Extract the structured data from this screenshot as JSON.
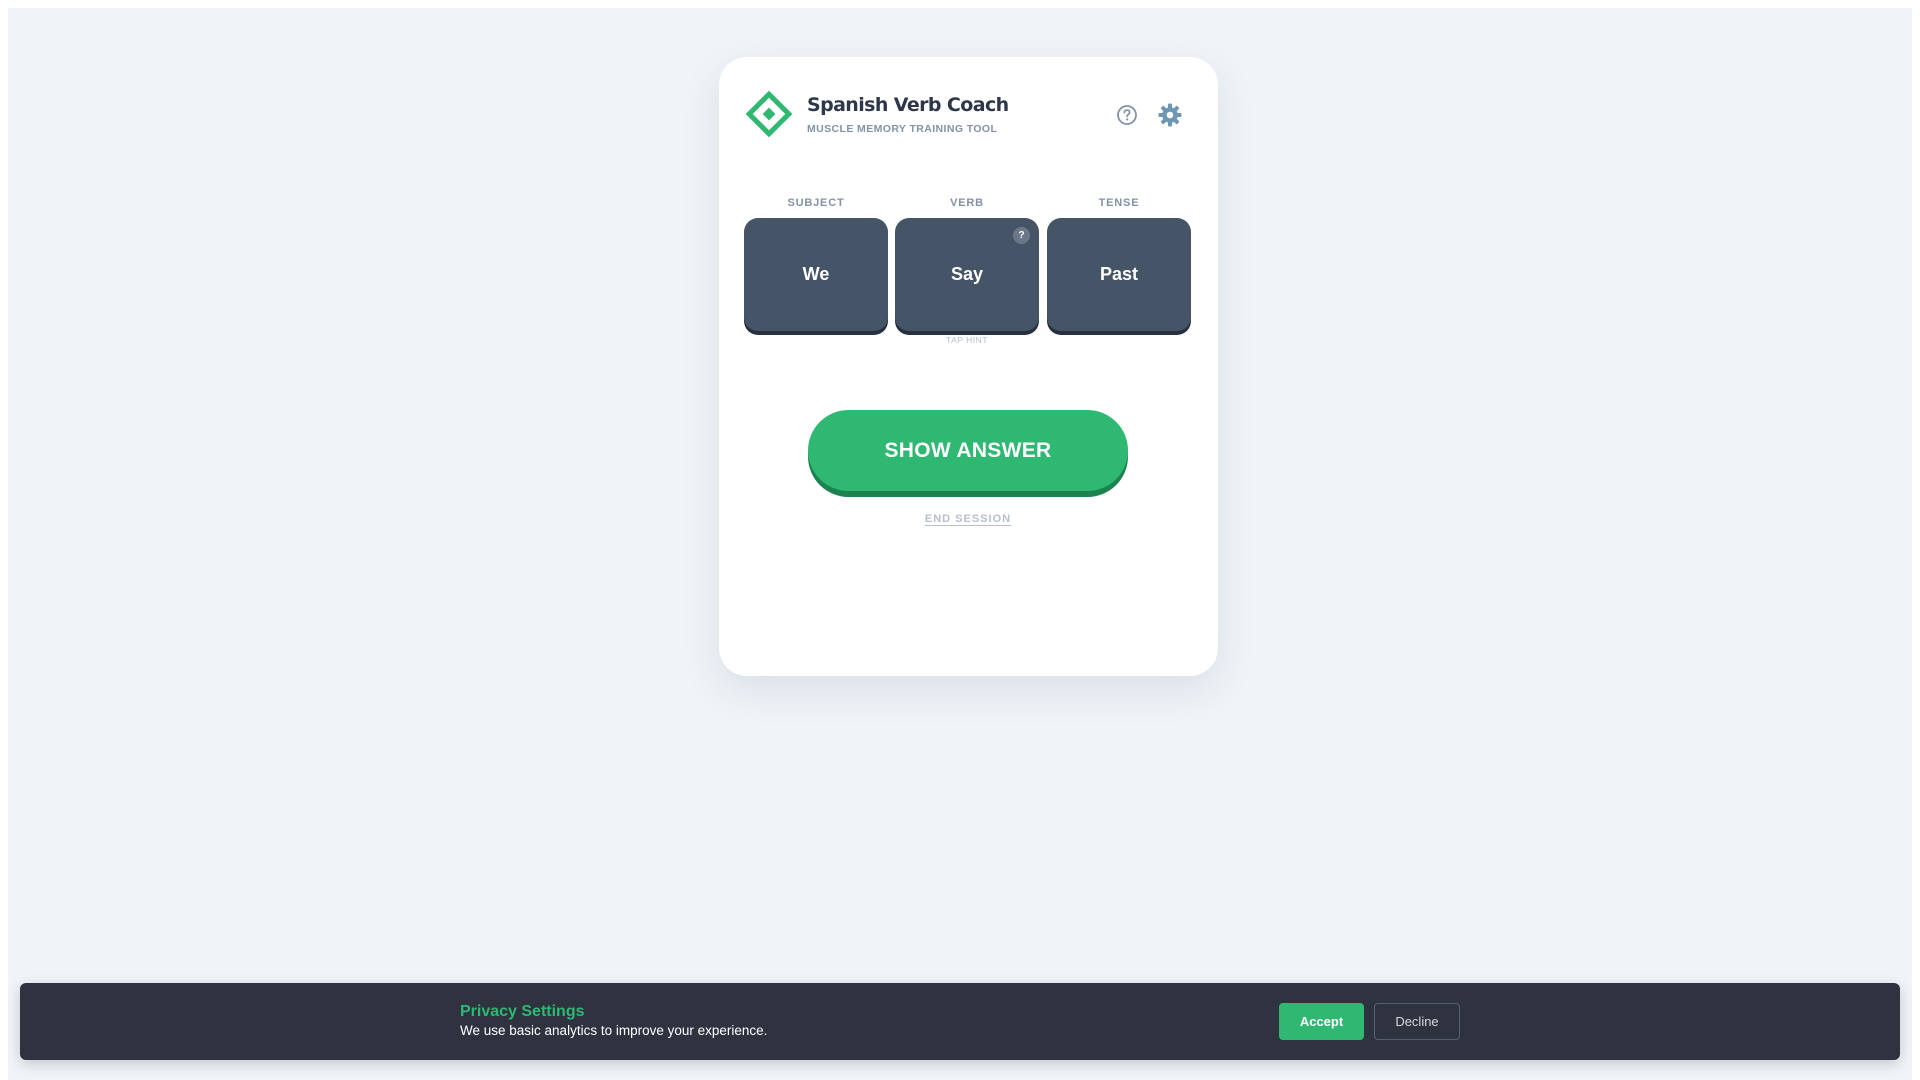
{
  "app": {
    "title": "Spanish Verb Coach",
    "subtitle": "MUSCLE MEMORY TRAINING TOOL",
    "logo_icon": "diamond-logo-icon",
    "header_icons": [
      "help-circle-icon",
      "gear-icon"
    ]
  },
  "columns": [
    {
      "label": "SUBJECT",
      "value": "We"
    },
    {
      "label": "VERB",
      "value": "Say",
      "hint_badge": "?",
      "hint_text": "TAP HINT"
    },
    {
      "label": "TENSE",
      "value": "Past"
    }
  ],
  "actions": {
    "show_answer": "SHOW ANSWER",
    "end_session": "END SESSION"
  },
  "consent": {
    "title": "Privacy Settings",
    "text": "We use basic analytics to improve your experience.",
    "accept": "Accept",
    "decline": "Decline"
  },
  "colors": {
    "accent": "#2eb872",
    "tile": "#465467",
    "background": "#f0f4f8",
    "banner": "#2f3340"
  }
}
